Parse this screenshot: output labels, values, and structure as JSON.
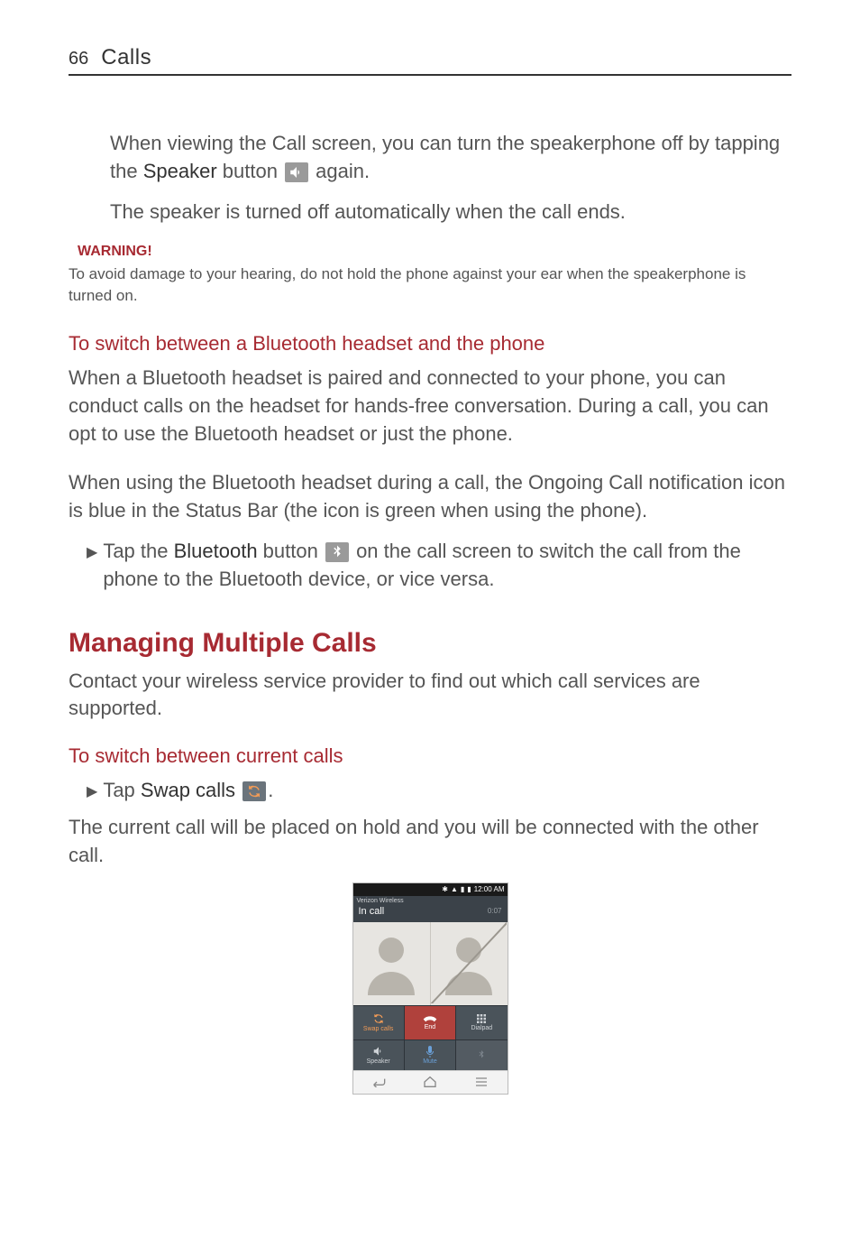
{
  "header": {
    "page_number": "66",
    "section": "Calls"
  },
  "top": {
    "p1_a": "When viewing the Call screen, you can turn the speakerphone off by tapping the ",
    "p1_bold": "Speaker",
    "p1_b": " button ",
    "p1_c": " again.",
    "p2": "The speaker is turned off automatically when the call ends."
  },
  "warning": {
    "label": "WARNING!",
    "text": "To avoid damage to your hearing, do not hold the phone against your ear when the speakerphone is turned on."
  },
  "bluetooth_section": {
    "heading": "To switch between a Bluetooth headset and the phone",
    "p1": "When a Bluetooth headset is paired and connected to your phone, you can conduct calls on the headset for hands-free conversation. During a call, you can opt to use the Bluetooth headset or just the phone.",
    "p2": "When using the Bluetooth headset during a call, the Ongoing Call notification icon is blue in the Status Bar (the icon is green when using the phone).",
    "bullet_a": "Tap the ",
    "bullet_bold": "Bluetooth",
    "bullet_b": " button ",
    "bullet_c": " on the call screen to switch the call from the phone to the Bluetooth device, or vice versa."
  },
  "managing": {
    "heading": "Managing Multiple Calls",
    "p1": "Contact your wireless service provider to find out which call services are supported."
  },
  "switch_calls": {
    "heading": "To switch between current calls",
    "bullet_a": "Tap ",
    "bullet_bold": "Swap calls",
    "bullet_b": " ",
    "bullet_c": ".",
    "p2": "The current call will be placed on hold and you will be connected with the other call."
  },
  "screenshot": {
    "status_time": "12:00 AM",
    "carrier": "Verizon Wireless",
    "state_label": "In call",
    "duration": "0:07",
    "buttons": {
      "swap": "Swap calls",
      "end": "End",
      "dialpad": "Dialpad",
      "speaker": "Speaker",
      "mute": "Mute",
      "bluetooth": ""
    }
  }
}
